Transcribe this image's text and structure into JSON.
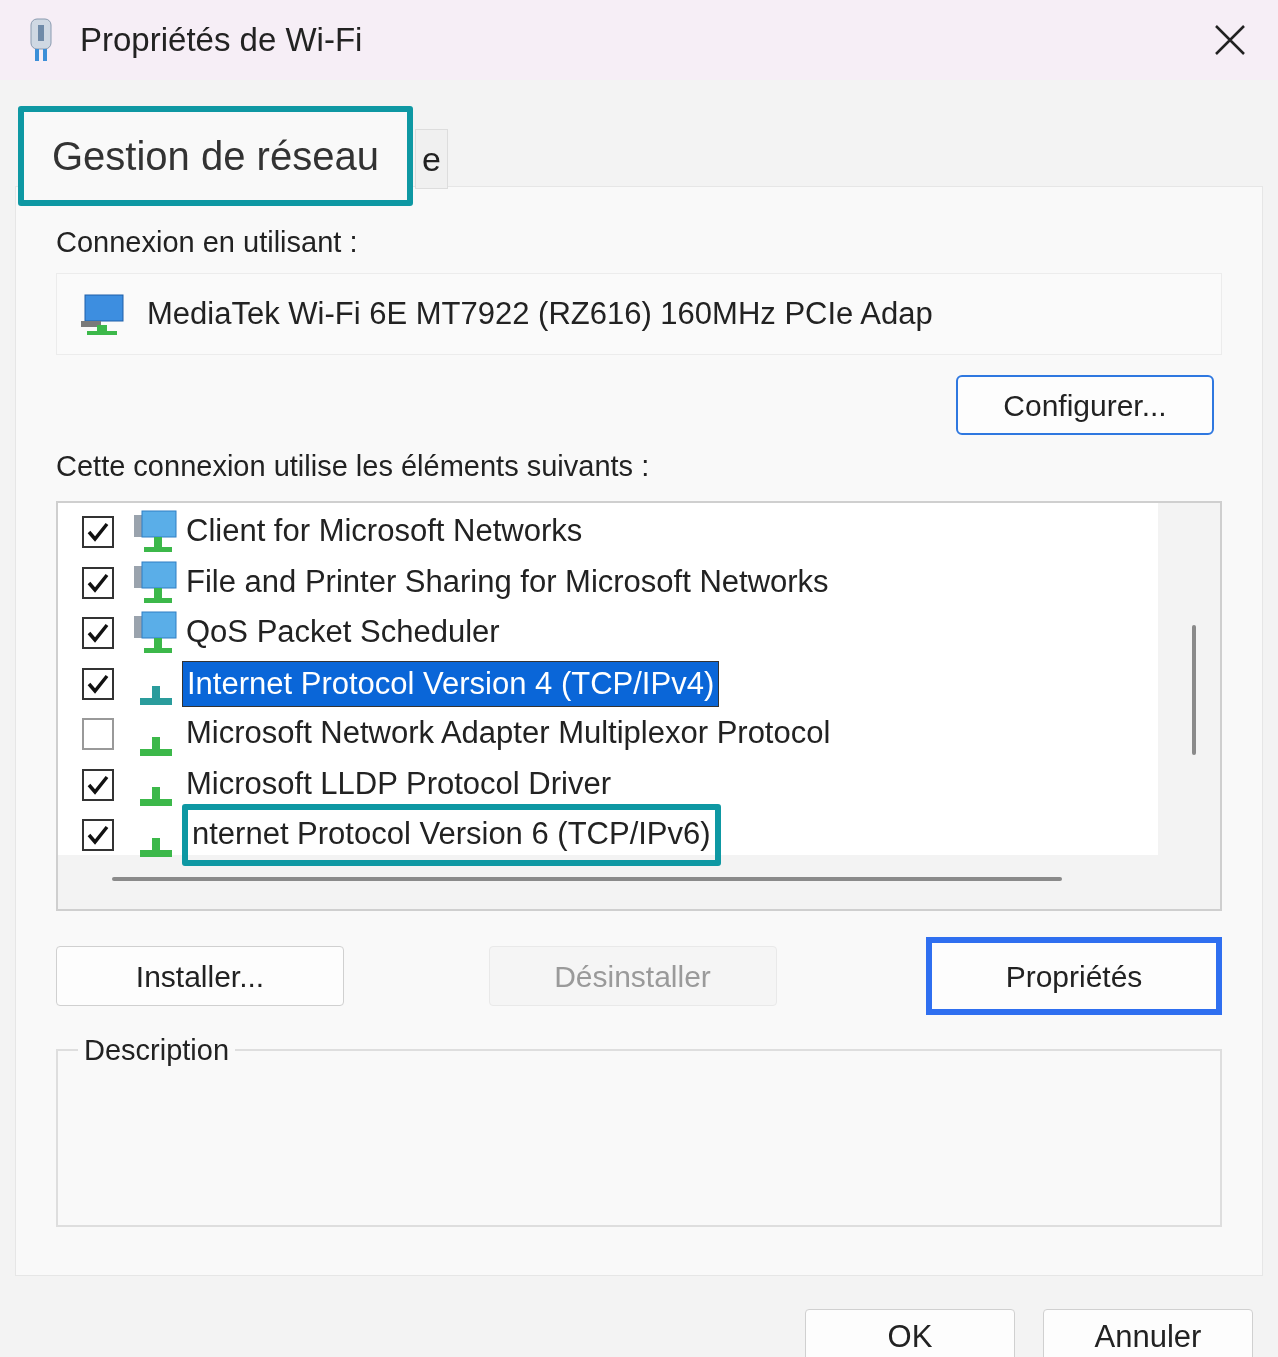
{
  "window": {
    "title": "Propriétés de Wi-Fi"
  },
  "tabs": [
    {
      "label": "Gestion de réseau",
      "selected": true,
      "highlighted": true
    },
    {
      "label": "e",
      "selected": false
    }
  ],
  "connection": {
    "label": "Connexion en utilisant :",
    "adapter": "MediaTek Wi-Fi 6E MT7922 (RZ616) 160MHz PCIe Adap",
    "configure_button": "Configurer..."
  },
  "components": {
    "label": "Cette connexion utilise les éléments suivants :",
    "items": [
      {
        "label": "Client for Microsoft Networks",
        "kind": "service",
        "checked": true,
        "selected": false
      },
      {
        "label": "File and Printer Sharing for Microsoft Networks",
        "kind": "service",
        "checked": true,
        "selected": false
      },
      {
        "label": "QoS Packet Scheduler",
        "kind": "service",
        "checked": true,
        "selected": false
      },
      {
        "label": "Internet Protocol Version 4 (TCP/IPv4)",
        "kind": "protocol",
        "checked": true,
        "selected": true
      },
      {
        "label": "Microsoft Network Adapter Multiplexor Protocol",
        "kind": "protocol",
        "checked": false,
        "selected": false
      },
      {
        "label": "Microsoft LLDP Protocol Driver",
        "kind": "protocol",
        "checked": true,
        "selected": false
      },
      {
        "label": "nternet Protocol Version 6 (TCP/IPv6)",
        "kind": "protocol",
        "checked": true,
        "selected": false,
        "highlighted": true
      }
    ]
  },
  "actions": [
    {
      "label": "Installer...",
      "disabled": false
    },
    {
      "label": "Désinstaller",
      "disabled": true
    },
    {
      "label": "Propriétés",
      "disabled": false,
      "highlighted": true
    }
  ],
  "description": {
    "label": "Description"
  },
  "buttons": [
    "OK",
    "Annuler"
  ]
}
